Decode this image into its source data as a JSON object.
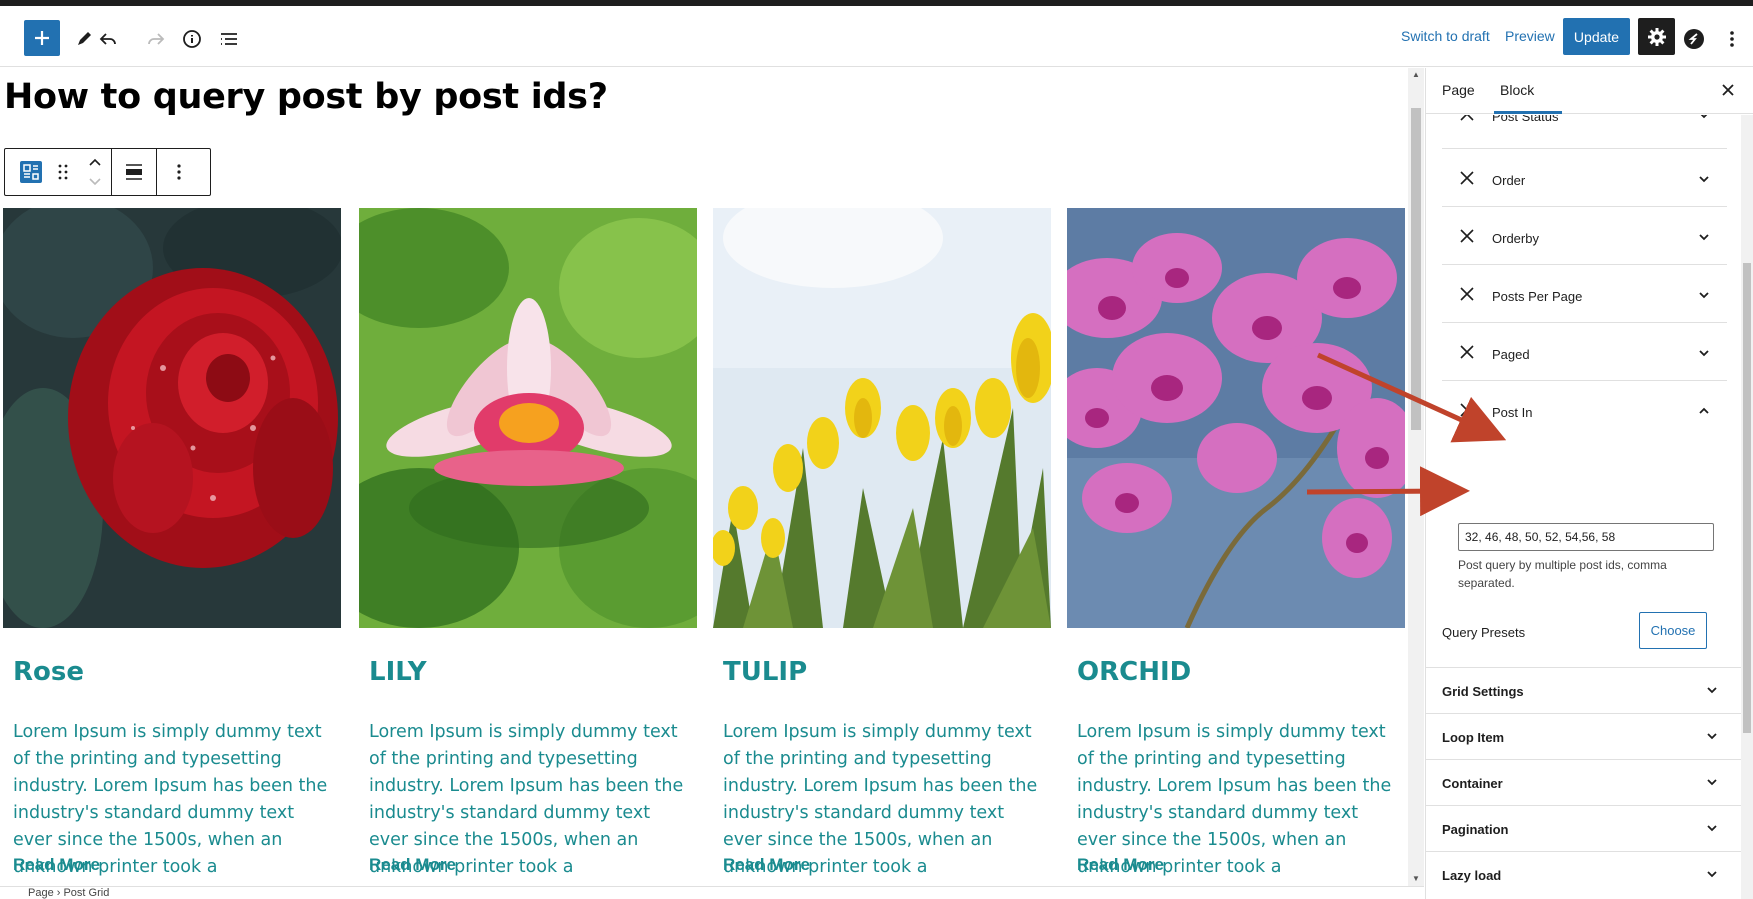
{
  "header": {
    "switch_to_draft": "Switch to draft",
    "preview": "Preview",
    "update": "Update",
    "icons": [
      "plus-icon",
      "pencil-icon",
      "undo-icon",
      "redo-icon",
      "info-icon",
      "list-view-icon",
      "gear-icon",
      "plugin-icon",
      "more-vertical-icon"
    ]
  },
  "post": {
    "title": "How to query post by post ids?"
  },
  "cards": [
    {
      "title": "Rose",
      "text": "Lorem Ipsum is simply dummy text of the printing and typesetting industry. Lorem Ipsum has been the industry's standard dummy text ever since the 1500s, when an unknown printer took a",
      "readmore": "Read More"
    },
    {
      "title": "LILY",
      "text": "Lorem Ipsum is simply dummy text of the printing and typesetting industry. Lorem Ipsum has been the industry's standard dummy text ever since the 1500s, when an unknown printer took a",
      "readmore": "Read More"
    },
    {
      "title": "TULIP",
      "text": "Lorem Ipsum is simply dummy text of the printing and typesetting industry. Lorem Ipsum has been the industry's standard dummy text ever since the 1500s, when an unknown printer took a",
      "readmore": "Read More"
    },
    {
      "title": "ORCHID",
      "text": "Lorem Ipsum is simply dummy text of the printing and typesetting industry. Lorem Ipsum has been the industry's standard dummy text ever since the 1500s, when an unknown printer took a",
      "readmore": "Read More"
    }
  ],
  "footer": {
    "breadcrumb": "Page  ›  Post Grid"
  },
  "sidebar": {
    "tabs": [
      "Page",
      "Block"
    ],
    "query_rows": [
      "Post Status",
      "Order",
      "Orderby",
      "Posts Per Page",
      "Paged",
      "Post In"
    ],
    "post_in_value": "32, 46, 48, 50, 52, 54,56, 58",
    "post_in_help": "Post query by multiple post ids, comma separated.",
    "query_presets_label": "Query Presets",
    "choose_label": "Choose",
    "panels": [
      "Grid Settings",
      "Loop Item",
      "Container",
      "Pagination",
      "Lazy load"
    ]
  },
  "colors": {
    "accent": "#2271b1",
    "heading": "#1a8b8f",
    "annotation_arrow": "#c0432b"
  }
}
